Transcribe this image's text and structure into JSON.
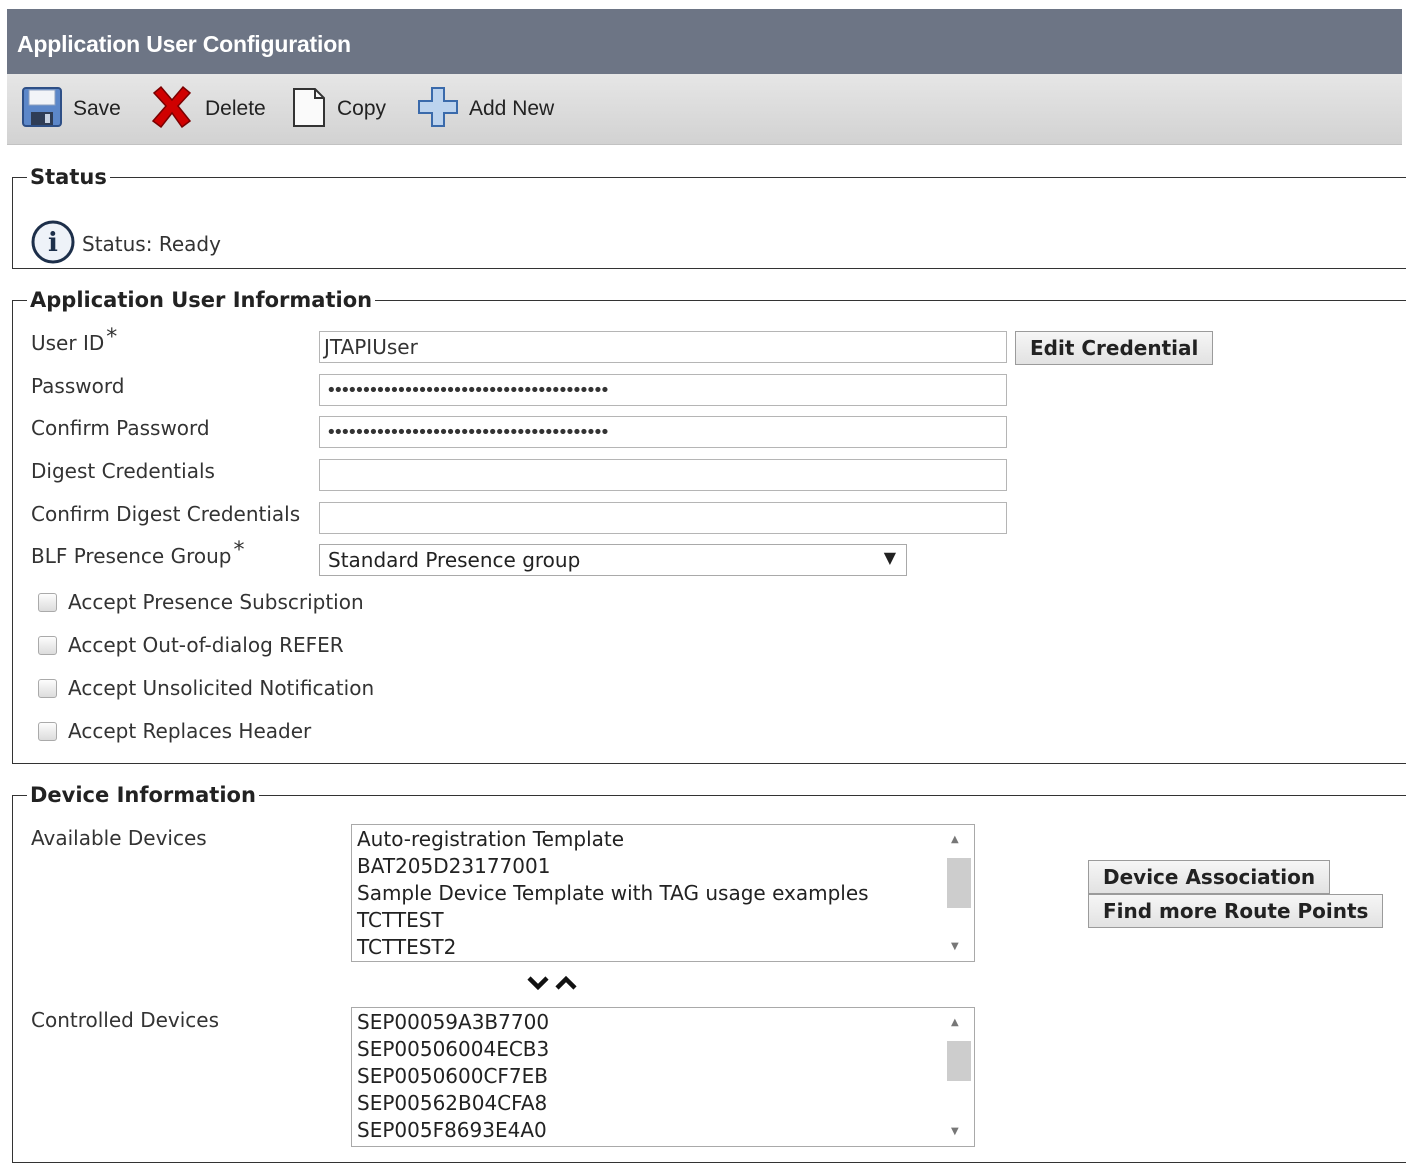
{
  "header": {
    "title": "Application User Configuration"
  },
  "toolbar": {
    "save": "Save",
    "delete": "Delete",
    "copy": "Copy",
    "add_new": "Add New"
  },
  "status": {
    "legend": "Status",
    "text": "Status: Ready"
  },
  "app_user": {
    "legend": "Application User Information",
    "user_id_label": "User ID",
    "user_id_value": "JTAPIUser",
    "edit_credential": "Edit Credential",
    "password_label": "Password",
    "password_value": "••••••••••••••••••••••••••••••••••••••••",
    "confirm_password_label": "Confirm Password",
    "confirm_password_value": "••••••••••••••••••••••••••••••••••••••••",
    "digest_label": "Digest Credentials",
    "confirm_digest_label": "Confirm Digest Credentials",
    "blf_label": "BLF Presence Group",
    "blf_value": "Standard Presence group",
    "required_mark": "*",
    "checkboxes": [
      {
        "label": "Accept Presence Subscription",
        "checked": false
      },
      {
        "label": "Accept Out-of-dialog REFER",
        "checked": false
      },
      {
        "label": "Accept Unsolicited Notification",
        "checked": false
      },
      {
        "label": "Accept Replaces Header",
        "checked": false
      }
    ]
  },
  "device_info": {
    "legend": "Device Information",
    "available_label": "Available Devices",
    "available_devices": [
      "Auto-registration Template",
      "BAT205D23177001",
      "Sample Device Template with TAG usage examples",
      "TCTTEST",
      "TCTTEST2"
    ],
    "device_association": "Device Association",
    "find_route_points": "Find more Route Points",
    "controlled_label": "Controlled Devices",
    "controlled_devices": [
      "SEP00059A3B7700",
      "SEP00506004ECB3",
      "SEP0050600CF7EB",
      "SEP00562B04CFA8",
      "SEP005F8693E4A0"
    ]
  },
  "icons": {
    "save": "floppy-disk-icon",
    "delete": "red-x-icon",
    "copy": "document-icon",
    "add_new": "plus-icon",
    "status": "info-icon",
    "move_down": "chevron-down-icon",
    "move_up": "chevron-up-icon"
  },
  "colors": {
    "title_bar": "#6d7585",
    "delete_red": "#d00000",
    "add_blue": "#4a7fc1"
  }
}
